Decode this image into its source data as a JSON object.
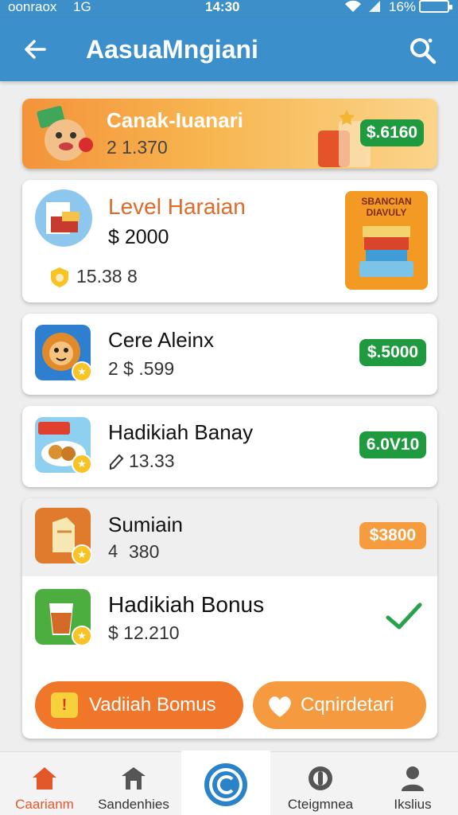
{
  "status": {
    "carrier": "oonraox",
    "network": "1G",
    "time": "14:30",
    "battery": "16%"
  },
  "header": {
    "title": "AasuaMngiani"
  },
  "banner": {
    "title": "Canak-Iuanari",
    "sub": "2 1.370",
    "price": "$.6160"
  },
  "featured": {
    "title": "Level Haraian",
    "price": "$ 2000",
    "stat": "15.38 8",
    "box_label": "SBANCIAN\nDIAVULY"
  },
  "items": [
    {
      "title": "Cere Aleinx",
      "sub": "2 $ .599",
      "price": "$.5000"
    },
    {
      "title": "Hadikiah Banay",
      "sub": "13.33",
      "price": "6.0V10"
    },
    {
      "title": "Sumiain",
      "sub": "380",
      "price": "$3800"
    },
    {
      "title": "Hadikiah Bonus",
      "sub": "$ 12.210"
    }
  ],
  "actions": {
    "primary": "Vadiiah Bomus",
    "secondary": "Cqnirdetari"
  },
  "nav": [
    {
      "label": "Caarianm"
    },
    {
      "label": "Sandenhies"
    },
    {
      "label": "Cteigmnea"
    },
    {
      "label": "Ikslius"
    }
  ],
  "colors": {
    "header": "#3b8fcb",
    "accent_orange": "#f0772a",
    "price_green": "#1f9a3e"
  }
}
